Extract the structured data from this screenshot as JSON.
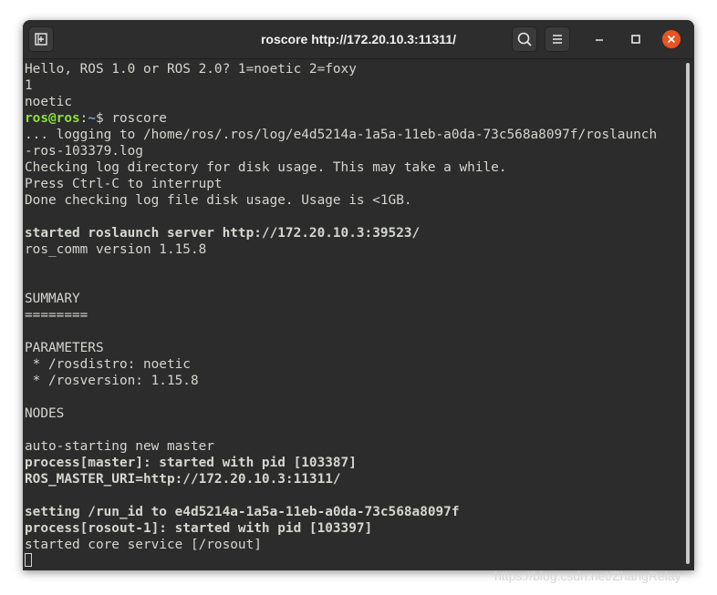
{
  "window": {
    "title": "roscore http://172.20.10.3:11311/"
  },
  "titlebar": {
    "icons": {
      "new_tab": "new-tab-icon",
      "search": "search-icon",
      "menu": "hamburger-menu-icon",
      "minimize": "minimize-icon",
      "maximize": "maximize-icon",
      "close": "close-icon"
    },
    "close_color": "#e95420"
  },
  "terminal": {
    "colors": {
      "background": "#2c2c2c",
      "foreground": "#d3d7cf",
      "prompt_user": "#8ae234",
      "prompt_path": "#729fcf"
    },
    "lines": [
      "Hello, ROS 1.0 or ROS 2.0? 1=noetic 2=foxy",
      "1",
      "noetic",
      "",
      "... logging to /home/ros/.ros/log/e4d5214a-1a5a-11eb-a0da-73c568a8097f/roslaunch",
      "-ros-103379.log",
      "Checking log directory for disk usage. This may take a while.",
      "Press Ctrl-C to interrupt",
      "Done checking log file disk usage. Usage is <1GB.",
      "",
      "started roslaunch server http://172.20.10.3:39523/",
      "ros_comm version 1.15.8",
      "",
      "",
      "SUMMARY",
      "========",
      "",
      "PARAMETERS",
      " * /rosdistro: noetic",
      " * /rosversion: 1.15.8",
      "",
      "NODES",
      "",
      "auto-starting new master",
      "process[master]: started with pid [103387]",
      "ROS_MASTER_URI=http://172.20.10.3:11311/",
      "",
      "setting /run_id to e4d5214a-1a5a-11eb-a0da-73c568a8097f",
      "process[rosout-1]: started with pid [103397]",
      "started core service [/rosout]"
    ],
    "prompt": {
      "user_host": "ros@ros",
      "separator": ":",
      "path": "~",
      "symbol": "$ ",
      "command": "roscore"
    }
  },
  "watermark": "https://blog.csdn.net/ZhangRelay"
}
